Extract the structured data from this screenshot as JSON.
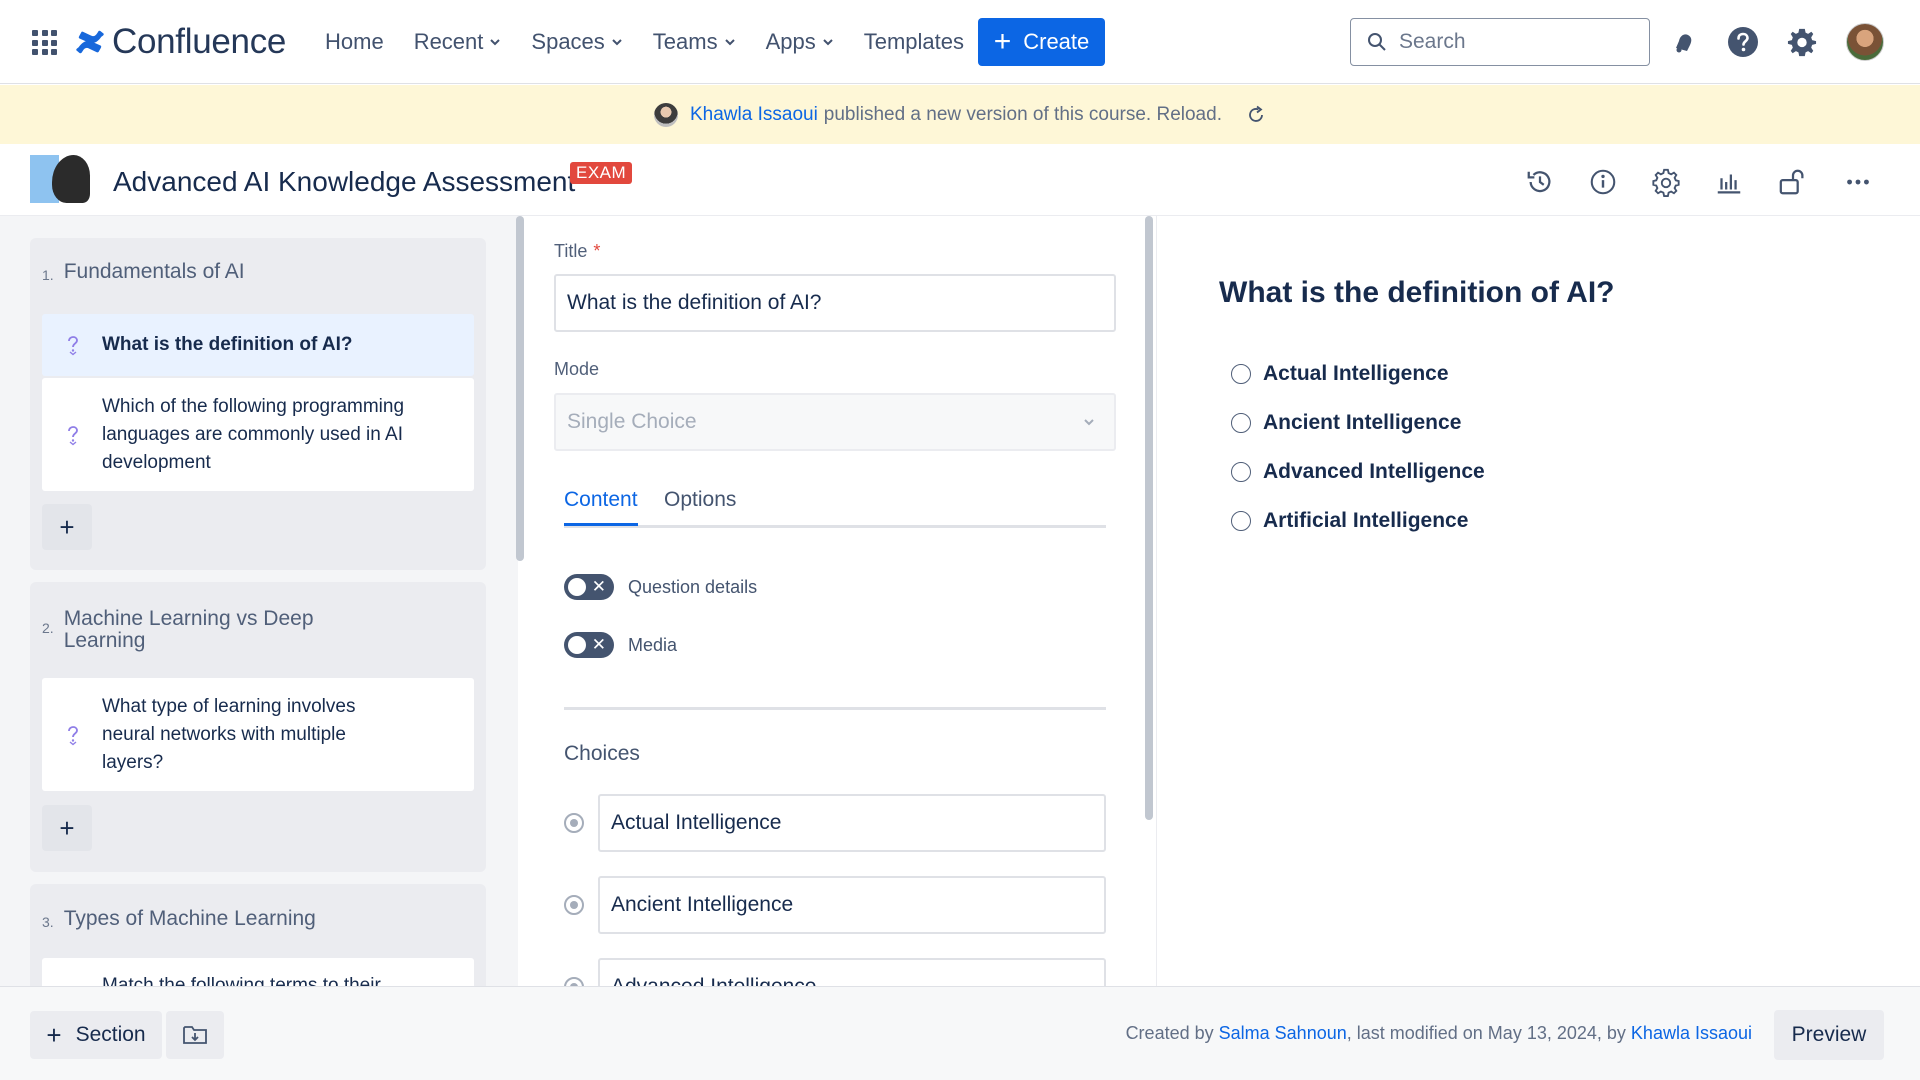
{
  "nav": {
    "logo_text": "Confluence",
    "items": [
      {
        "label": "Home",
        "has_menu": false
      },
      {
        "label": "Recent",
        "has_menu": true
      },
      {
        "label": "Spaces",
        "has_menu": true
      },
      {
        "label": "Teams",
        "has_menu": true
      },
      {
        "label": "Apps",
        "has_menu": true
      },
      {
        "label": "Templates",
        "has_menu": false
      }
    ],
    "create_label": "Create",
    "search_placeholder": "Search",
    "accent_color": "#0C66E4"
  },
  "banner": {
    "user": "Khawla Issaoui",
    "message": "published a new version of this course. Reload.",
    "background": "#FEF7D7"
  },
  "page": {
    "title": "Advanced AI Knowledge Assessment",
    "badge": "EXAM",
    "badge_color": "#E2483D",
    "header_icons": [
      "history-icon",
      "info-icon",
      "settings-icon",
      "analytics-icon",
      "unlock-icon",
      "more-icon"
    ]
  },
  "sidebar": {
    "sections": [
      {
        "number": "1.",
        "title": "Fundamentals of AI",
        "questions": [
          {
            "text": "What is the definition of AI?",
            "active": true
          },
          {
            "text": "Which of the following programming languages are commonly used in AI development",
            "active": false
          }
        ]
      },
      {
        "number": "2.",
        "title": "Machine Learning vs Deep Learning",
        "questions": [
          {
            "text": "What type of learning involves neural networks with multiple layers?",
            "active": false
          }
        ]
      },
      {
        "number": "3.",
        "title": "Types of Machine Learning",
        "questions": [
          {
            "text": "Match the following terms to their",
            "active": false
          }
        ]
      }
    ],
    "add_label": "+"
  },
  "editor": {
    "title_label": "Title",
    "title_required_mark": "*",
    "title_value": "What is the definition of AI?",
    "mode_label": "Mode",
    "mode_value": "Single Choice",
    "tabs": [
      "Content",
      "Options"
    ],
    "active_tab": "Content",
    "toggles": [
      {
        "label": "Question details",
        "on": false
      },
      {
        "label": "Media",
        "on": false
      }
    ],
    "choices_label": "Choices",
    "choices": [
      "Actual Intelligence",
      "Ancient Intelligence",
      "Advanced Intelligence"
    ]
  },
  "preview": {
    "question": "What is the definition of AI?",
    "options": [
      "Actual Intelligence",
      "Ancient Intelligence",
      "Advanced Intelligence",
      "Artificial Intelligence"
    ]
  },
  "footer": {
    "section_label": "Section",
    "created_prefix": "Created by",
    "creator": "Salma Sahnoun",
    "modified_text": ", last modified on May 13, 2024, by",
    "modifier": "Khawla Issaoui",
    "preview_label": "Preview"
  }
}
